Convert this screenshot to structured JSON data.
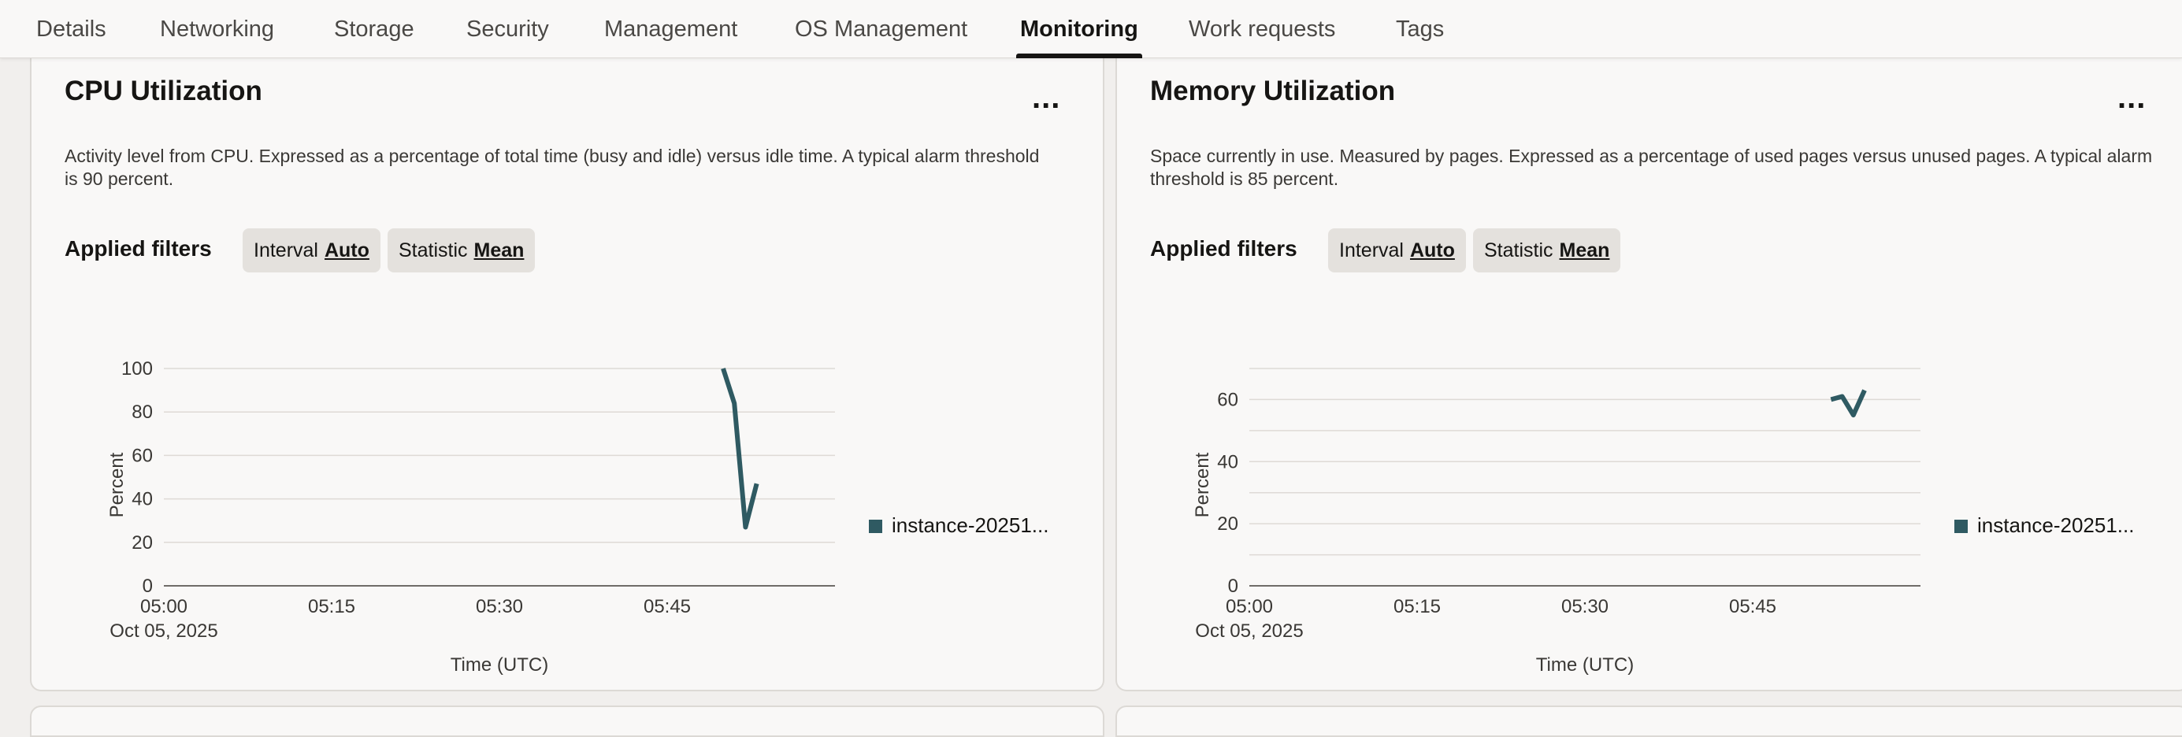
{
  "tabs": [
    {
      "label": "Details",
      "active": false
    },
    {
      "label": "Networking",
      "active": false
    },
    {
      "label": "Storage",
      "active": false
    },
    {
      "label": "Security",
      "active": false
    },
    {
      "label": "Management",
      "active": false
    },
    {
      "label": "OS Management",
      "active": false
    },
    {
      "label": "Monitoring",
      "active": true
    },
    {
      "label": "Work requests",
      "active": false
    },
    {
      "label": "Tags",
      "active": false
    }
  ],
  "cards": [
    {
      "title": "CPU Utilization",
      "more_label": "...",
      "description": "Activity level from CPU. Expressed as a percentage of total time (busy and idle) versus idle time. A typical alarm threshold is 90 percent.",
      "filters_label": "Applied filters",
      "filters": [
        {
          "name": "Interval",
          "value": "Auto"
        },
        {
          "name": "Statistic",
          "value": "Mean"
        }
      ]
    },
    {
      "title": "Memory Utilization",
      "more_label": "...",
      "description": "Space currently in use. Measured by pages. Expressed as a percentage of used pages versus unused pages. A typical alarm threshold is 85 percent.",
      "filters_label": "Applied filters",
      "filters": [
        {
          "name": "Interval",
          "value": "Auto"
        },
        {
          "name": "Statistic",
          "value": "Mean"
        }
      ]
    }
  ],
  "chart_data": [
    {
      "type": "line",
      "xlabel": "Time (UTC)",
      "ylabel": "Percent",
      "x_ticks": [
        "05:00",
        "05:15",
        "05:30",
        "05:45"
      ],
      "x_tick_sublabel": "Oct 05, 2025",
      "x_range": [
        "05:00",
        "06:00"
      ],
      "y_ticks": [
        0,
        20,
        40,
        60,
        80,
        100
      ],
      "ylim": [
        0,
        100
      ],
      "grid": true,
      "legend_position": "right",
      "series": [
        {
          "name": "instance-20251...",
          "x": [
            "05:50",
            "05:51",
            "05:52",
            "05:53"
          ],
          "y": [
            100,
            84,
            27,
            47
          ],
          "color": "#2f5a62"
        }
      ]
    },
    {
      "type": "line",
      "xlabel": "Time (UTC)",
      "ylabel": "Percent",
      "x_ticks": [
        "05:00",
        "05:15",
        "05:30",
        "05:45"
      ],
      "x_tick_sublabel": "Oct 05, 2025",
      "x_range": [
        "05:00",
        "06:00"
      ],
      "y_ticks": [
        0,
        20,
        40,
        60
      ],
      "ylim": [
        0,
        70
      ],
      "grid": true,
      "legend_position": "right",
      "series": [
        {
          "name": "instance-20251...",
          "x": [
            "05:52",
            "05:53",
            "05:54",
            "05:55"
          ],
          "y": [
            60,
            61,
            55,
            63
          ],
          "color": "#2f5a62"
        }
      ]
    }
  ]
}
